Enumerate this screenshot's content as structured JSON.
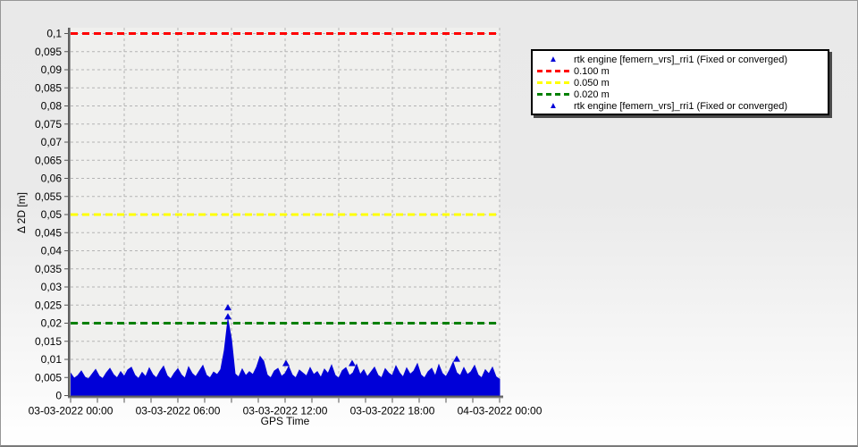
{
  "chart_data": {
    "type": "scatter",
    "title": "",
    "xlabel": "GPS Time",
    "ylabel": "Δ 2D [m]",
    "ylim": [
      0,
      0.1
    ],
    "y_tick_step": 0.005,
    "y_tick_labels": [
      "0,1",
      "0,095",
      "0,09",
      "0,085",
      "0,08",
      "0,075",
      "0,07",
      "0,065",
      "0,06",
      "0,055",
      "0,05",
      "0,045",
      "0,04",
      "0,035",
      "0,03",
      "0,025",
      "0,02",
      "0,015",
      "0,01",
      "0,005",
      "0"
    ],
    "x_range_hours": [
      0,
      24
    ],
    "x_tick_hours": [
      0,
      6,
      12,
      18,
      24
    ],
    "x_tick_labels": [
      "03-03-2022 00:00",
      "03-03-2022 06:00",
      "03-03-2022 12:00",
      "03-03-2022 18:00",
      "04-03-2022 00:00"
    ],
    "x_minor_tick_step_hours": 1.5,
    "v_grid_step_hours": 3,
    "grid": true,
    "plot_bg": "#f0f0ee",
    "grid_color": "#b4b4b4",
    "axis_color": "#555555",
    "ref_lines": [
      {
        "label": "0.100 m",
        "value": 0.1,
        "color": "#ff0000"
      },
      {
        "label": "0.050 m",
        "value": 0.05,
        "color": "#ffff00"
      },
      {
        "label": "0.020 m",
        "value": 0.02,
        "color": "#008000"
      }
    ],
    "series": [
      {
        "name": "rtk engine [femern_vrs]_rri1 (Fixed or converged)",
        "marker": "triangle",
        "color": "#0000d8",
        "envelope_hours_step": 0.2,
        "envelope_max_m": [
          0.0062,
          0.0048,
          0.0055,
          0.0068,
          0.0051,
          0.0046,
          0.0059,
          0.0072,
          0.0054,
          0.0047,
          0.0063,
          0.0075,
          0.0058,
          0.0049,
          0.0066,
          0.0053,
          0.0071,
          0.0078,
          0.0056,
          0.0047,
          0.0064,
          0.0052,
          0.0076,
          0.0058,
          0.0049,
          0.0067,
          0.0081,
          0.0055,
          0.0046,
          0.0062,
          0.0074,
          0.0057,
          0.0048,
          0.0079,
          0.0061,
          0.0052,
          0.0068,
          0.0083,
          0.0056,
          0.0049,
          0.0065,
          0.0058,
          0.0072,
          0.0125,
          0.021,
          0.0155,
          0.006,
          0.0051,
          0.0073,
          0.0055,
          0.0066,
          0.0058,
          0.0078,
          0.0108,
          0.0095,
          0.0057,
          0.0049,
          0.0068,
          0.0075,
          0.0053,
          0.0061,
          0.008,
          0.0057,
          0.0049,
          0.007,
          0.0062,
          0.0054,
          0.0077,
          0.0058,
          0.0066,
          0.005,
          0.0073,
          0.0061,
          0.0084,
          0.0056,
          0.0048,
          0.0069,
          0.0077,
          0.0055,
          0.0063,
          0.0086,
          0.0058,
          0.0071,
          0.0052,
          0.0065,
          0.0078,
          0.0056,
          0.0049,
          0.0074,
          0.0062,
          0.0055,
          0.0082,
          0.0063,
          0.0051,
          0.0076,
          0.0059,
          0.0068,
          0.0088,
          0.0057,
          0.0049,
          0.0066,
          0.0075,
          0.0054,
          0.0085,
          0.0061,
          0.0052,
          0.007,
          0.0092,
          0.0063,
          0.0055,
          0.0077,
          0.0058,
          0.0066,
          0.0083,
          0.0057,
          0.0049,
          0.0071,
          0.006,
          0.0078,
          0.0052,
          0.0045
        ],
        "outliers": [
          [
            8.8,
            0.0243
          ],
          [
            8.8,
            0.0218
          ],
          [
            12.05,
            0.0089
          ],
          [
            15.75,
            0.0089
          ],
          [
            21.6,
            0.0101
          ]
        ]
      }
    ],
    "legend": {
      "position": "top-right",
      "entries": [
        {
          "marker": "triangle",
          "color": "#0000d8",
          "label": "rtk engine [femern_vrs]_rri1 (Fixed or converged)"
        },
        {
          "marker": "dashes",
          "color": "#ff0000",
          "label": "0.100 m"
        },
        {
          "marker": "dashes",
          "color": "#ffff00",
          "label": "0.050 m"
        },
        {
          "marker": "dashes",
          "color": "#008000",
          "label": "0.020 m"
        },
        {
          "marker": "triangle",
          "color": "#0000d8",
          "label": "rtk engine [femern_vrs]_rri1 (Fixed or converged)"
        }
      ]
    }
  }
}
